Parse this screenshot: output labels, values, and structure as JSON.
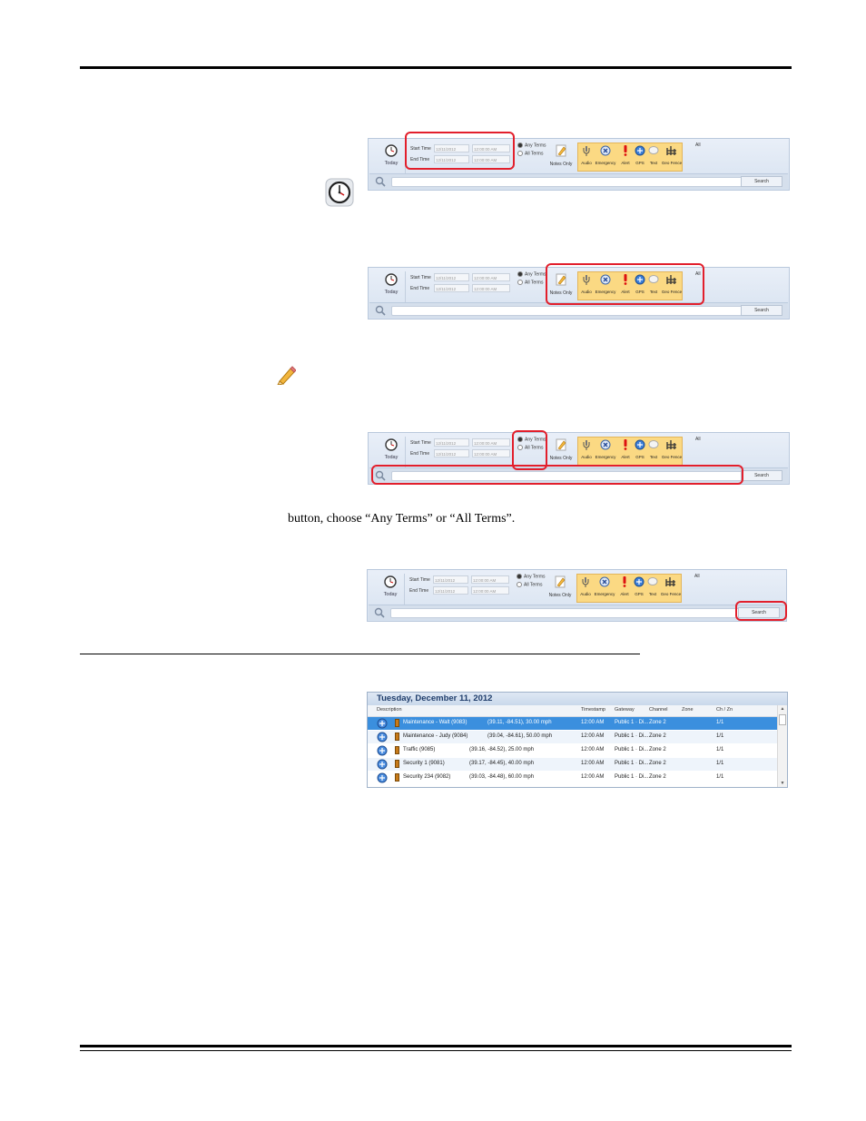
{
  "body": {
    "instruction_fragment": "button, choose “Any Terms” or “All Terms”."
  },
  "ribbon": {
    "today_label": "Today",
    "start_time_label": "Start Time",
    "end_time_label": "End Time",
    "start_date": "12/11/2012",
    "end_date": "12/11/2012",
    "start_time": "12:00:00 AM",
    "end_time": "12:00:00 AM",
    "any_terms": "Any Terms",
    "all_terms": "All Terms",
    "notes_only": "Notes Only",
    "audio": "Audio",
    "emergency": "Emergency",
    "alert": "Alert",
    "gps": "GPS",
    "text": "Text",
    "geo_fence": "Geo Fence",
    "all": "All",
    "search_button": "Search"
  },
  "results": {
    "title": "Tuesday, December 11, 2012",
    "columns": [
      "Description",
      "Timestamp",
      "Gateway",
      "Channel",
      "Zone",
      "Ch / Zn"
    ],
    "rows": [
      {
        "description": "Maintenance - Walt (9083)",
        "location": "(39.11, -84.51), 30.00 mph",
        "timestamp": "12:00 AM",
        "gateway": "Public 1 · Di...",
        "channel": "Zone 2",
        "chzn": "1/1"
      },
      {
        "description": "Maintenance - Judy (9084)",
        "location": "(39.04, -84.61), 50.00 mph",
        "timestamp": "12:00 AM",
        "gateway": "Public 1 · Di...",
        "channel": "Zone 2",
        "chzn": "1/1"
      },
      {
        "description": "Traffic (9085)",
        "location": "(39.16, -84.52), 25.00 mph",
        "timestamp": "12:00 AM",
        "gateway": "Public 1 · Di...",
        "channel": "Zone 2",
        "chzn": "1/1"
      },
      {
        "description": "Security 1 (9081)",
        "location": "(39.17, -84.45), 40.00 mph",
        "timestamp": "12:00 AM",
        "gateway": "Public 1 · Di...",
        "channel": "Zone 2",
        "chzn": "1/1"
      },
      {
        "description": "Security 234 (9082)",
        "location": "(39.03, -84.48), 60.00 mph",
        "timestamp": "12:00 AM",
        "gateway": "Public 1 · Di...",
        "channel": "Zone 2",
        "chzn": "1/1"
      }
    ]
  }
}
